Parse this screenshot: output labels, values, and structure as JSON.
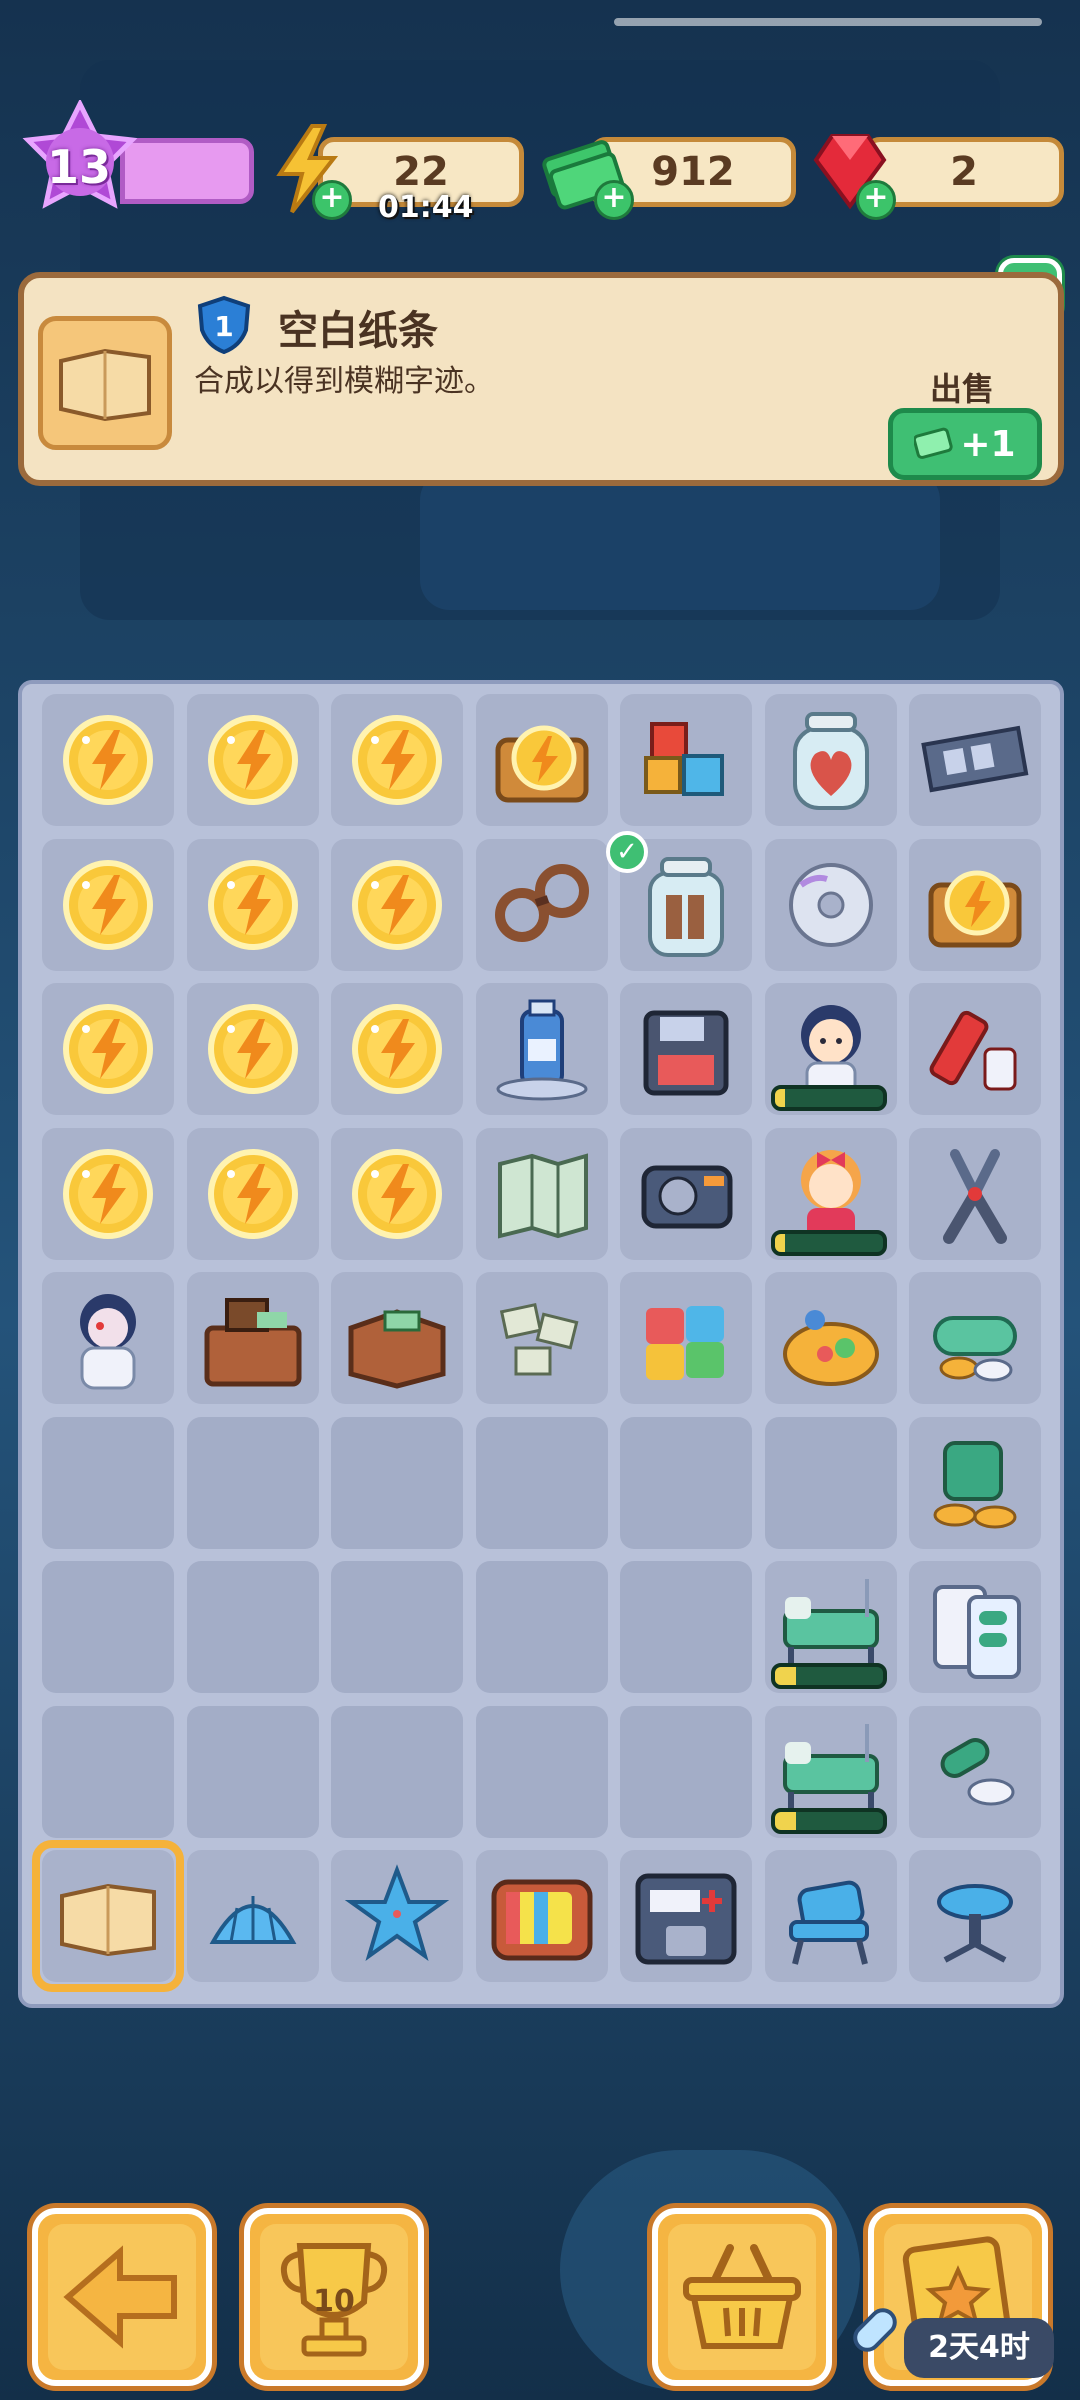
{
  "header": {
    "level": "13",
    "energy": "22",
    "energy_timer": "01:44",
    "cash": "912",
    "gems": "2"
  },
  "info_panel": {
    "item_level": "1",
    "title": "空白纸条",
    "description": "合成以得到模糊字迹。",
    "sell_label": "出售",
    "sell_value": "+1"
  },
  "board": {
    "rows": [
      [
        "energy-orb",
        "energy-orb",
        "energy-orb",
        "energy-chest",
        "toy-blocks",
        "heart-jar",
        "film-strip"
      ],
      [
        "energy-orb",
        "energy-orb",
        "energy-orb",
        "handcuffs",
        "boots-jar",
        "cd-disc",
        "energy-chest"
      ],
      [
        "energy-orb",
        "energy-orb",
        "energy-orb",
        "iv-bottle",
        "floppy-disk",
        "girl-character",
        "syringe-kit"
      ],
      [
        "energy-orb",
        "energy-orb",
        "energy-orb",
        "paper-map",
        "tape-device",
        "red-bow-girl",
        "pliers"
      ],
      [
        "nurse-ghost",
        "cash-desk",
        "cash-box",
        "paper-scraps",
        "puzzle-pieces",
        "board-game",
        "pill-pile"
      ],
      [
        "",
        "",
        "",
        "",
        "",
        "",
        "pill-bottle-pile"
      ],
      [
        "",
        "",
        "",
        "",
        "",
        "hospital-bed",
        "blister-pack"
      ],
      [
        "",
        "",
        "",
        "",
        "",
        "hospital-bed",
        "capsules"
      ],
      [
        "blank-note",
        "shell",
        "starfish",
        "retro-tv",
        "medical-machine",
        "waiting-chair",
        "stool"
      ]
    ],
    "progress": {
      "girl-character": 0.1,
      "red-bow-girl": 0.1,
      "hospital-bed-1": 0.2,
      "hospital-bed-2": 0.2
    }
  },
  "bottom": {
    "trophy_count": "10",
    "task_timer": "2天4时"
  },
  "colors": {
    "board_bg": "#b8c1d9",
    "cell_bg": "#a9b2cb",
    "panel_bg": "#f4e3c2",
    "green": "#3fbf73",
    "orange": "#f5b542"
  }
}
